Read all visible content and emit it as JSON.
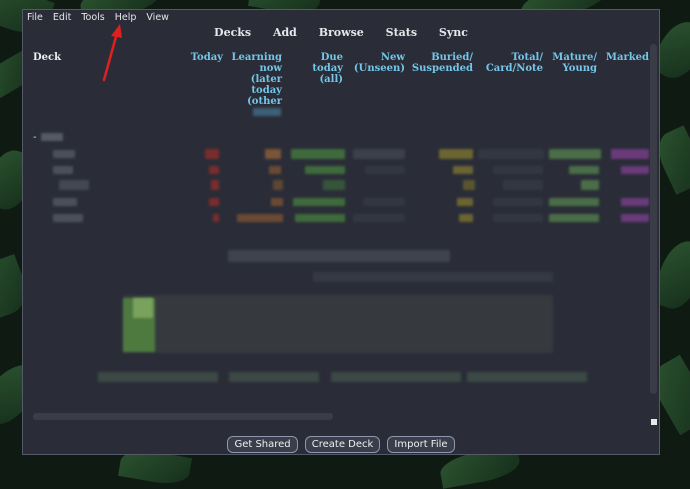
{
  "menubar": {
    "items": [
      {
        "label": "File"
      },
      {
        "label": "Edit"
      },
      {
        "label": "Tools"
      },
      {
        "label": "Help"
      },
      {
        "label": "View"
      }
    ]
  },
  "toolbar": {
    "items": [
      "Decks",
      "Add",
      "Browse",
      "Stats",
      "Sync"
    ]
  },
  "table": {
    "headers": {
      "deck": "Deck",
      "today": "Today",
      "learning": "Learning now (later today (other",
      "due": "Due today (all)",
      "new": "New (Unseen)",
      "buried": "Buried/ Suspended",
      "total": "Total/ Card/Note",
      "mature": "Mature/ Young",
      "marked": "Marked"
    },
    "collapse_marker": "-"
  },
  "buttons": {
    "get_shared": "Get Shared",
    "create_deck": "Create Deck",
    "import_file": "Import File"
  },
  "colors": {
    "window_bg": "#2a2d38",
    "header_accent": "#74c6e8",
    "annotation_arrow": "#e02020"
  }
}
